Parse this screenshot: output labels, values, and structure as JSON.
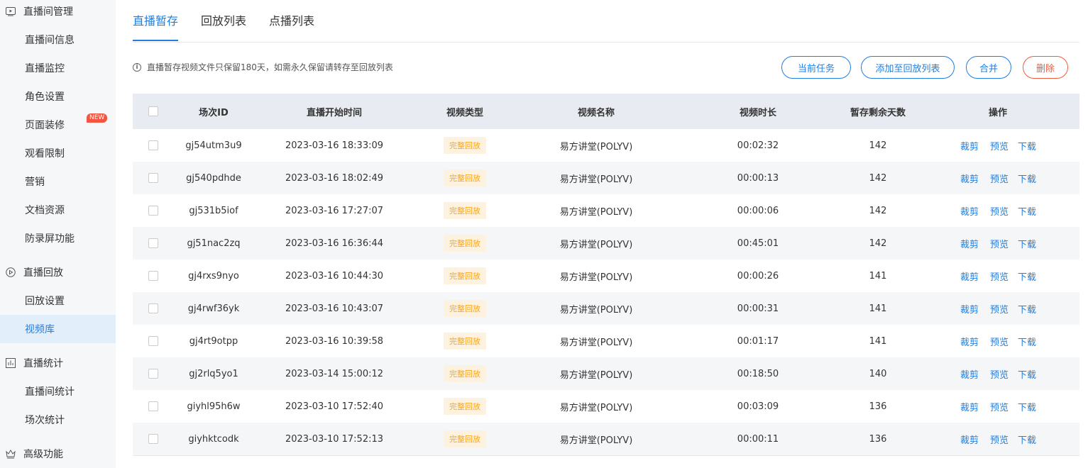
{
  "sidebar": {
    "groups": [
      {
        "label": "直播间管理",
        "icon": "live-room-icon",
        "children": [
          "直播间信息",
          "直播监控",
          "角色设置",
          "页面装修",
          "观看限制",
          "营销",
          "文档资源",
          "防录屏功能"
        ]
      },
      {
        "label": "直播回放",
        "icon": "replay-icon",
        "children": [
          "回放设置",
          "视频库"
        ]
      },
      {
        "label": "直播统计",
        "icon": "stats-icon",
        "children": [
          "直播间统计",
          "场次统计"
        ]
      },
      {
        "label": "高级功能",
        "icon": "crown-icon",
        "children": []
      }
    ],
    "new_badge": "NEW",
    "active_item": "视频库"
  },
  "tabs": [
    "直播暂存",
    "回放列表",
    "点播列表"
  ],
  "active_tab": "直播暂存",
  "notice": "直播暂存视频文件只保留180天，如需永久保留请转存至回放列表",
  "buttons": {
    "current_tasks": "当前任务",
    "add_to_replay": "添加至回放列表",
    "merge": "合并",
    "delete": "删除"
  },
  "table": {
    "headers": [
      "场次ID",
      "直播开始时间",
      "视频类型",
      "视频名称",
      "视频时长",
      "暂存剩余天数",
      "操作"
    ],
    "actions": [
      "裁剪",
      "预览",
      "下载"
    ],
    "rows": [
      {
        "id": "gj54utm3u9",
        "start": "2023-03-16 18:33:09",
        "type": "完整回放",
        "name": "易方讲堂(POLYV)",
        "duration": "00:02:32",
        "days": "142"
      },
      {
        "id": "gj540pdhde",
        "start": "2023-03-16 18:02:49",
        "type": "完整回放",
        "name": "易方讲堂(POLYV)",
        "duration": "00:00:13",
        "days": "142"
      },
      {
        "id": "gj531b5iof",
        "start": "2023-03-16 17:27:07",
        "type": "完整回放",
        "name": "易方讲堂(POLYV)",
        "duration": "00:00:06",
        "days": "142"
      },
      {
        "id": "gj51nac2zq",
        "start": "2023-03-16 16:36:44",
        "type": "完整回放",
        "name": "易方讲堂(POLYV)",
        "duration": "00:45:01",
        "days": "142"
      },
      {
        "id": "gj4rxs9nyo",
        "start": "2023-03-16 10:44:30",
        "type": "完整回放",
        "name": "易方讲堂(POLYV)",
        "duration": "00:00:26",
        "days": "141"
      },
      {
        "id": "gj4rwf36yk",
        "start": "2023-03-16 10:43:07",
        "type": "完整回放",
        "name": "易方讲堂(POLYV)",
        "duration": "00:00:31",
        "days": "141"
      },
      {
        "id": "gj4rt9otpp",
        "start": "2023-03-16 10:39:58",
        "type": "完整回放",
        "name": "易方讲堂(POLYV)",
        "duration": "00:01:17",
        "days": "141"
      },
      {
        "id": "gj2rlq5yo1",
        "start": "2023-03-14 15:00:12",
        "type": "完整回放",
        "name": "易方讲堂(POLYV)",
        "duration": "00:18:50",
        "days": "140"
      },
      {
        "id": "giyhl95h6w",
        "start": "2023-03-10 17:52:40",
        "type": "完整回放",
        "name": "易方讲堂(POLYV)",
        "duration": "00:03:09",
        "days": "136"
      },
      {
        "id": "giyhktcodk",
        "start": "2023-03-10 17:52:13",
        "type": "完整回放",
        "name": "易方讲堂(POLYV)",
        "duration": "00:00:11",
        "days": "136"
      }
    ]
  },
  "colors": {
    "accent": "#1f7fe0",
    "danger": "#ef5b3e",
    "tag_text": "#f5a623",
    "tag_bg": "#fdf2e0",
    "active_item_bg": "#e3eefb"
  }
}
